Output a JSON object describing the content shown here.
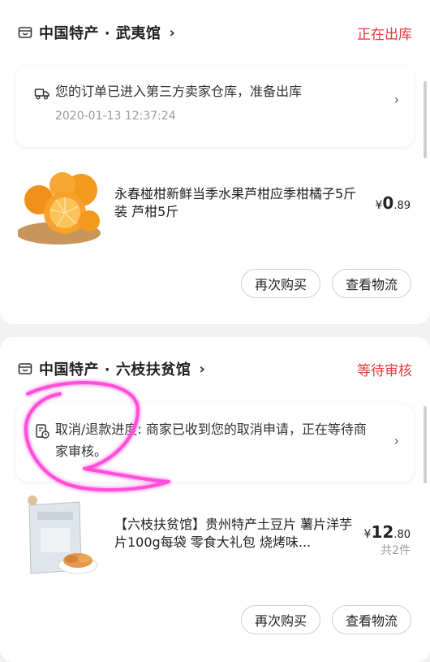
{
  "orders": [
    {
      "shop_name": "中国特产 · 武夷馆",
      "status": "正在出库",
      "info_text": "您的订单已进入第三方卖家仓库，准备出库",
      "info_time": "2020-01-13 12:37:24",
      "product_title": "永春椪柑新鲜当季水果芦柑应季柑橘子5斤装 芦柑5斤",
      "price_currency": "¥",
      "price_int": "0",
      "price_dec": ".89",
      "buttons": [
        "再次购买",
        "查看物流"
      ]
    },
    {
      "shop_name": "中国特产 · 六枝扶贫馆",
      "status": "等待审核",
      "info_label": "取消/退款进度:",
      "info_text_line1": "商家已收到您的取消申请，正在等待商",
      "info_text_line2": "家审核。",
      "product_title": "【六枝扶贫馆】贵州特产土豆片 薯片洋芋片100g每袋 零食大礼包 烧烤味...",
      "price_currency": "¥",
      "price_int": "12",
      "price_dec": ".80",
      "qty": "共2件",
      "buttons": [
        "再次购买",
        "查看物流"
      ]
    }
  ],
  "colors": {
    "accent": "#e4393c",
    "annotation": "#ff4fd8"
  },
  "icons": [
    "shop-icon",
    "truck-icon",
    "refund-icon",
    "chevron-right-icon"
  ]
}
